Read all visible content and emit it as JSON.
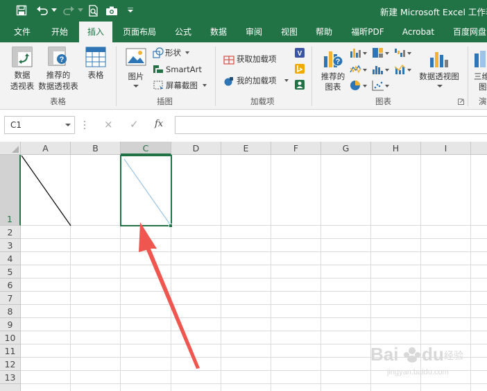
{
  "title_bar": {
    "window_title": "新建 Microsoft Excel 工作表"
  },
  "quick_access": {
    "icons": [
      "save-icon",
      "undo-icon",
      "redo-icon",
      "print-preview-icon",
      "camera-icon",
      "customize-icon"
    ]
  },
  "tabs": [
    "文件",
    "开始",
    "插入",
    "页面布局",
    "公式",
    "数据",
    "审阅",
    "视图",
    "帮助",
    "福昕PDF",
    "Acrobat",
    "百度网盘"
  ],
  "active_tab": "插入",
  "ribbon": {
    "tables": {
      "pivot_line1": "数据",
      "pivot_line2": "透视表",
      "recommended_line1": "推荐的",
      "recommended_line2": "数据透视表",
      "table": "表格",
      "group": "表格"
    },
    "illustrations": {
      "pictures": "图片",
      "shapes": "形状",
      "smartart": "SmartArt",
      "screenshot": "屏幕截图",
      "group": "插图"
    },
    "addins": {
      "get": "获取加载项",
      "my": "我的加载项",
      "group": "加载项"
    },
    "charts": {
      "recommended_line1": "推荐的",
      "recommended_line2": "图表",
      "pivot_chart": "数据透视图",
      "group": "图表"
    },
    "tours": {
      "map3d_line1": "三维",
      "map3d_line2": "图",
      "group": "演"
    }
  },
  "formula_bar": {
    "name_box": "C1",
    "cancel": "×",
    "enter": "✓",
    "fx": "fx",
    "content": ""
  },
  "grid": {
    "columns": [
      "A",
      "B",
      "C",
      "D",
      "E",
      "F",
      "G",
      "H",
      "I"
    ],
    "rows": [
      "1",
      "2",
      "3",
      "4",
      "5",
      "6",
      "7",
      "8",
      "9",
      "10",
      "11",
      "12",
      "13"
    ],
    "selected_cell": "C1"
  },
  "colors": {
    "excel_green": "#217346",
    "arrow_red": "#f05650",
    "diagonal_preview": "#9cc3e5"
  }
}
